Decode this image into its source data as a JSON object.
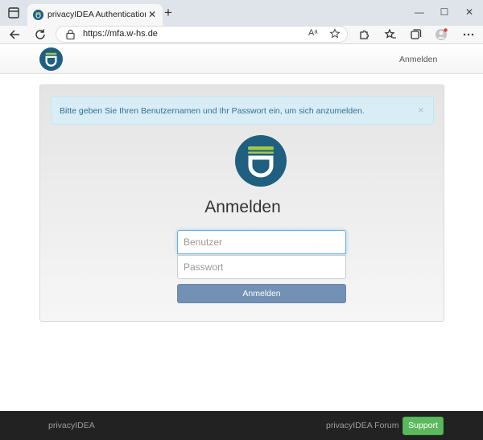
{
  "browser": {
    "tab_title": "privacyIDEA Authentication System",
    "tab_close": "✕",
    "new_tab": "+",
    "url": "https://mfa.w-hs.de",
    "read_aloud": "Aᵃ",
    "window_controls": {
      "minimize": "—",
      "maximize": "☐",
      "close": "✕"
    }
  },
  "navbar": {
    "login_link": "Anmelden"
  },
  "alert": {
    "text": "Bitte geben Sie Ihren Benutzernamen und Ihr Passwort ein, um sich anzumelden.",
    "close": "×"
  },
  "login": {
    "heading": "Anmelden",
    "username_placeholder": "Benutzer",
    "password_placeholder": "Passwort",
    "submit_label": "Anmelden"
  },
  "footer": {
    "brand": "privacyIDEA",
    "forum_link": "privacyIDEA Forum",
    "support_label": "Support"
  },
  "colors": {
    "logo_bg": "#1f5f7f",
    "logo_green": "#a3c945",
    "primary_button": "#7291b5",
    "support_button": "#5cb85c",
    "alert_bg": "#d9edf7"
  }
}
